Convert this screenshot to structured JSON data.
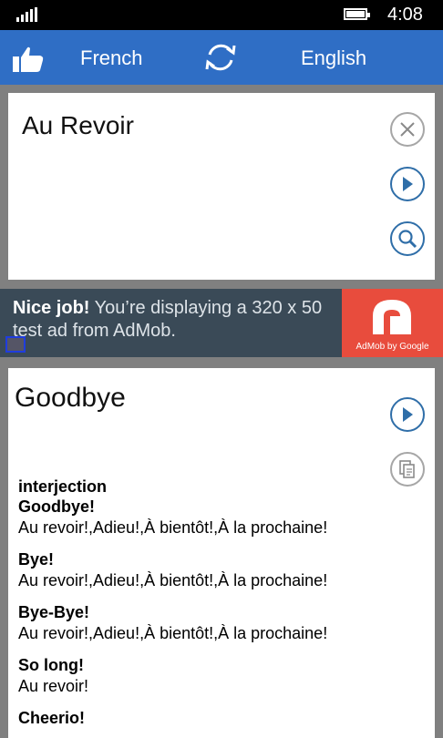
{
  "status_bar": {
    "time": "4:08",
    "signal_icon": "signal-bars-icon",
    "battery_icon": "battery-icon"
  },
  "header": {
    "like_icon": "thumbs-up-icon",
    "source_language": "French",
    "swap_icon": "swap-languages-icon",
    "target_language": "English",
    "background_color": "#2f6ec5"
  },
  "input": {
    "text": "Au Revoir",
    "clear_icon": "close-circle-icon",
    "play_icon": "play-circle-icon",
    "search_icon": "search-circle-icon"
  },
  "ad": {
    "headline": "Nice job!",
    "body": " You’re displaying a 320 x 50 test ad from AdMob.",
    "brand": "AdMob by Google",
    "info_icon": "info-icon",
    "logo_color": "#e84c3d"
  },
  "result": {
    "title": "Goodbye",
    "play_icon": "play-circle-icon",
    "copy_icon": "copy-circle-icon",
    "part_of_speech": "interjection",
    "entries": [
      {
        "term": "Goodbye!",
        "translations": "Au revoir!,Adieu!,À bientôt!,À la prochaine!"
      },
      {
        "term": "Bye!",
        "translations": "Au revoir!,Adieu!,À bientôt!,À la prochaine!"
      },
      {
        "term": "Bye-Bye!",
        "translations": "Au revoir!,Adieu!,À bientôt!,À la prochaine!"
      },
      {
        "term": "So long!",
        "translations": "Au revoir!"
      },
      {
        "term": "Cheerio!",
        "translations": ""
      }
    ]
  }
}
